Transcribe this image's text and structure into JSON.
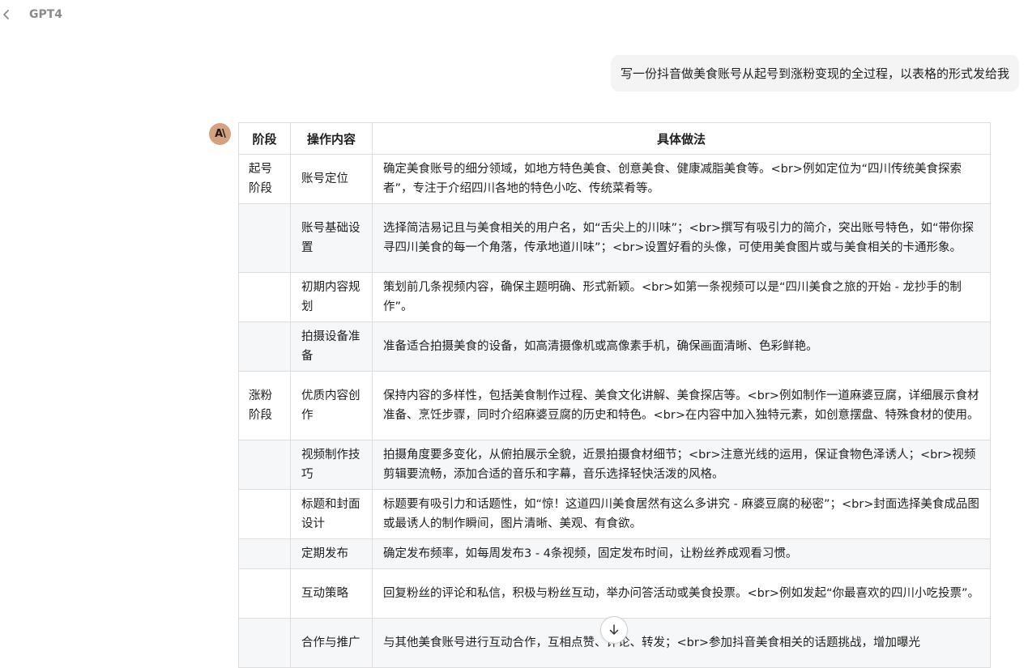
{
  "header": {
    "title": "GPT4"
  },
  "user_message": "写一份抖音做美食账号从起号到涨粉变现的全过程，以表格的形式发给我",
  "assistant": {
    "avatar_text": "A\\"
  },
  "table": {
    "headers": [
      "阶段",
      "操作内容",
      "具体做法"
    ],
    "rows": [
      {
        "stage": "起号阶段",
        "op": "账号定位",
        "detail": "确定美食账号的细分领域，如地方特色美食、创意美食、健康减脂美食等。<br>例如定位为“四川传统美食探索者”，专注于介绍四川各地的特色小吃、传统菜肴等。"
      },
      {
        "stage": "",
        "op": "账号基础设置",
        "detail": "选择简洁易记且与美食相关的用户名，如“舌尖上的川味”；<br>撰写有吸引力的简介，突出账号特色，如“带你探寻四川美食的每一个角落，传承地道川味”；<br>设置好看的头像，可使用美食图片或与美食相关的卡通形象。"
      },
      {
        "stage": "",
        "op": "初期内容规划",
        "detail": "策划前几条视频内容，确保主题明确、形式新颖。<br>如第一条视频可以是“四川美食之旅的开始 - 龙抄手的制作”。"
      },
      {
        "stage": "",
        "op": "拍摄设备准备",
        "detail": "准备适合拍摄美食的设备，如高清摄像机或高像素手机，确保画面清晰、色彩鲜艳。"
      },
      {
        "stage": "涨粉阶段",
        "op": "优质内容创作",
        "detail": "保持内容的多样性，包括美食制作过程、美食文化讲解、美食探店等。<br>例如制作一道麻婆豆腐，详细展示食材准备、烹饪步骤，同时介绍麻婆豆腐的历史和特色。<br>在内容中加入独特元素，如创意摆盘、特殊食材的使用。"
      },
      {
        "stage": "",
        "op": "视频制作技巧",
        "detail": "拍摄角度要多变化，从俯拍展示全貌，近景拍摄食材细节；<br>注意光线的运用，保证食物色泽诱人；<br>视频剪辑要流畅，添加合适的音乐和字幕，音乐选择轻快活泼的风格。"
      },
      {
        "stage": "",
        "op": "标题和封面设计",
        "detail": "标题要有吸引力和话题性，如“惊！这道四川美食居然有这么多讲究 - 麻婆豆腐的秘密”；<br>封面选择美食成品图或最诱人的制作瞬间，图片清晰、美观、有食欲。"
      },
      {
        "stage": "",
        "op": "定期发布",
        "detail": "确定发布频率，如每周发布3 - 4条视频，固定发布时间，让粉丝养成观看习惯。"
      },
      {
        "stage": "",
        "op": "互动策略",
        "detail": "回复粉丝的评论和私信，积极与粉丝互动，举办问答活动或美食投票。<br>例如发起“你最喜欢的四川小吃投票”。"
      },
      {
        "stage": "",
        "op": "合作与推广",
        "detail": "与其他美食账号进行互动合作，互相点赞、评论、转发；<br>参加抖音美食相关的话题挑战，增加曝光"
      }
    ]
  },
  "scroll_button": {
    "icon": "arrow-down-icon"
  }
}
